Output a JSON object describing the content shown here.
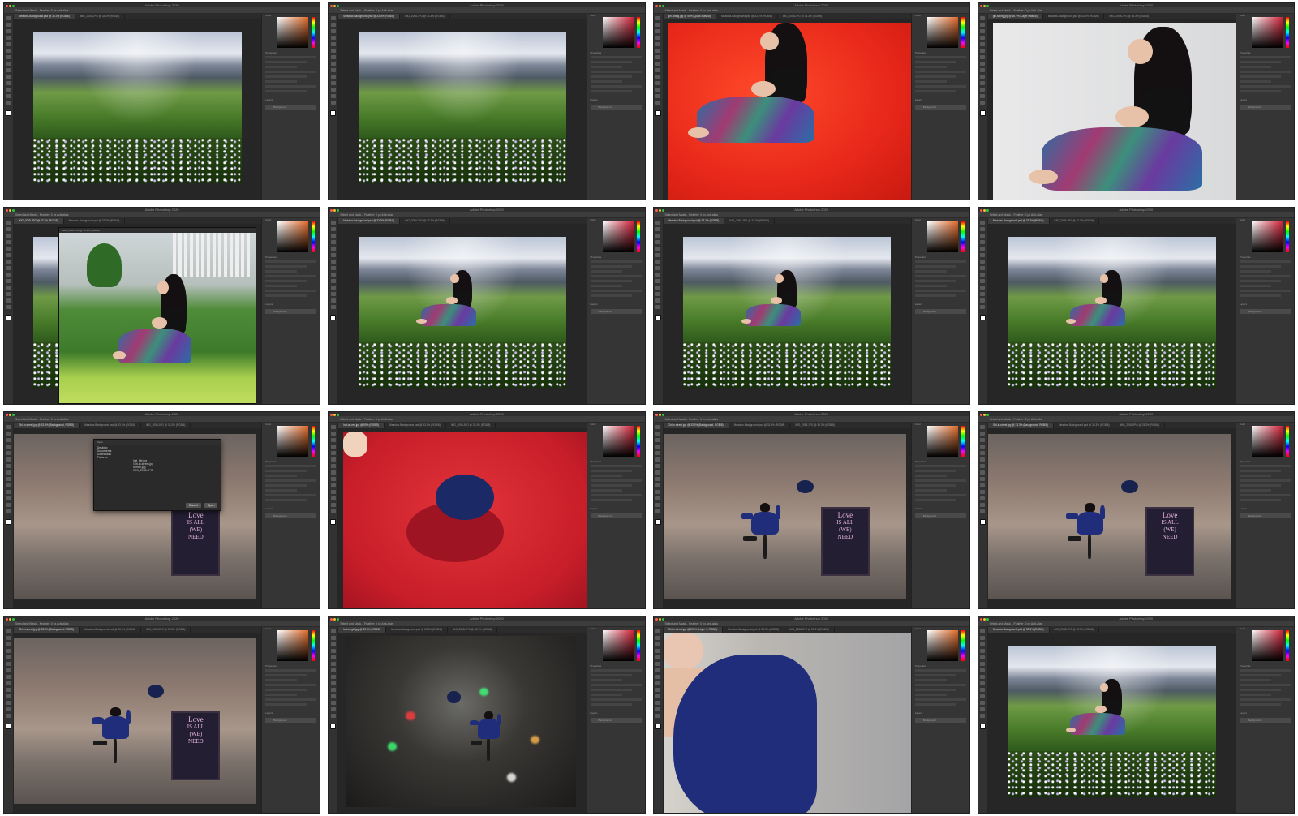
{
  "app_title": "Adobe Photoshop 2020",
  "tab_labels": {
    "landscape": "Meadow-Background.psd @ 33.3% (RGB/8)",
    "red_girl": "girl-sitting.jpg @ 50% (Quick Mask/8)",
    "gray_girl": "girl-sitting.jpg @ 66.7% (Layer Mask/8)",
    "garden": "IMG_2058.JPG @ 33.3% (RGB/8)",
    "street": "Girl-in-street.jpg @ 33.3% (Background, RGB/8)",
    "hat": "hat-on-red.jpg @ 50% (RGB/8)",
    "tunnel": "tunnel-girl.jpg @ 33.3% (RGB/8)",
    "closeup": "Girl-in-street.jpg @ 200% (Layer 1, RGB/8)"
  },
  "options_bar": "Select and Mask...   Feather: 0 px   Anti-alias",
  "panels": {
    "color": "Color",
    "properties": "Properties",
    "layers": "Layers",
    "background_layer": "Background"
  },
  "dialog": {
    "title": "Open",
    "favorites": [
      "Desktop",
      "Documents",
      "Downloads",
      "Pictures"
    ],
    "files": [
      "hat_file.jpg",
      "Girl-in-street.jpg",
      "tunnel.jpg",
      "IMG_2058.JPG"
    ],
    "cancel": "Cancel",
    "open": "Open"
  },
  "sign": {
    "line1": "Love",
    "line2": "IS ALL",
    "line3": "(WE)",
    "line4": "NEED"
  },
  "colors": {
    "ui_dark": "#3a3a3a",
    "panel": "#353535",
    "accent_red": "#e8281a"
  },
  "frames": [
    {
      "scene": "landscape",
      "tab": "landscape"
    },
    {
      "scene": "landscape",
      "tab": "landscape"
    },
    {
      "scene": "red_girl",
      "tab": "red_girl"
    },
    {
      "scene": "gray_girl",
      "tab": "gray_girl"
    },
    {
      "scene": "garden",
      "tab": "garden"
    },
    {
      "scene": "landscape_girl",
      "tab": "landscape"
    },
    {
      "scene": "landscape_girl",
      "tab": "landscape"
    },
    {
      "scene": "landscape_girl",
      "tab": "landscape"
    },
    {
      "scene": "street_dialog",
      "tab": "street"
    },
    {
      "scene": "hat",
      "tab": "hat"
    },
    {
      "scene": "street_girl",
      "tab": "street"
    },
    {
      "scene": "street_girl",
      "tab": "street"
    },
    {
      "scene": "street_girl",
      "tab": "street"
    },
    {
      "scene": "tunnel",
      "tab": "tunnel"
    },
    {
      "scene": "closeup",
      "tab": "closeup"
    },
    {
      "scene": "landscape_girl",
      "tab": "landscape"
    }
  ]
}
